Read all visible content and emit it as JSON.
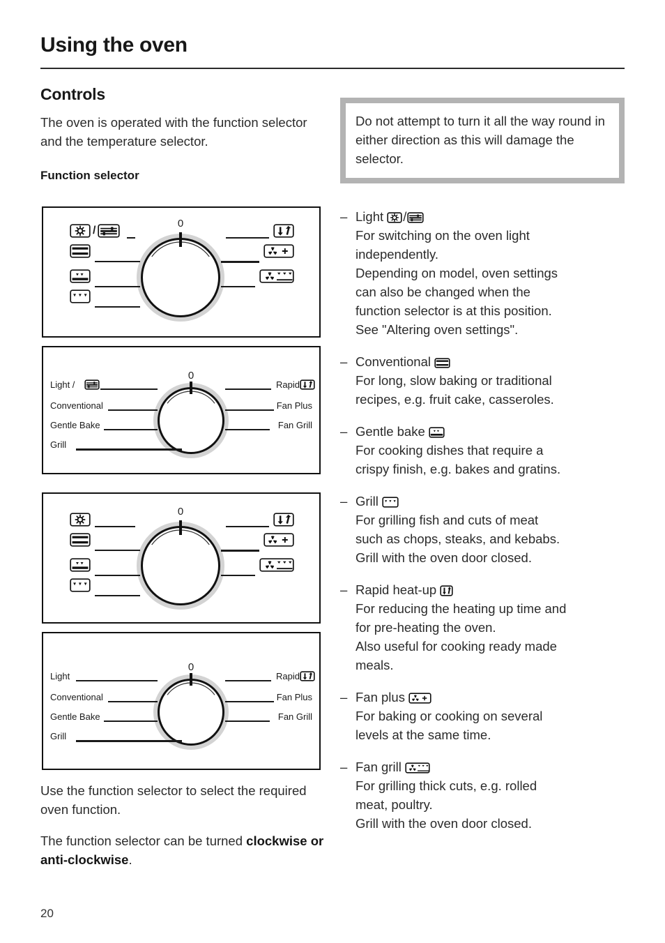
{
  "document": {
    "header_title": "Using the oven",
    "page_number": "20"
  },
  "left": {
    "section_title": "Controls",
    "intro": "The oven is operated with the function selector and the temperature selector.",
    "subsection_title": "Function selector",
    "closing_1": "Use the function selector to select the required oven function.",
    "closing_2_prefix": "The function selector can be turned ",
    "closing_2_bold": "clockwise or anti-clockwise",
    "closing_2_suffix": "."
  },
  "warning": {
    "text": "Do not attempt to turn it all the way round in either direction as this will damage the selector.",
    "border_color": "#b3b3b3"
  },
  "diagrams": [
    {
      "id": "diagram-1",
      "style": "icons",
      "zero_label": "0",
      "left_items": [
        {
          "name": "light-and-settings",
          "icon": "light-slash-settings"
        },
        {
          "name": "conventional",
          "icon": "conventional"
        },
        {
          "name": "gentle-bake",
          "icon": "gentle-bake"
        },
        {
          "name": "grill",
          "icon": "grill"
        }
      ],
      "right_items": [
        {
          "name": "rapid-heat-up",
          "icon": "rapid-heat-up"
        },
        {
          "name": "fan-plus",
          "icon": "fan-plus"
        },
        {
          "name": "fan-grill",
          "icon": "fan-grill"
        }
      ]
    },
    {
      "id": "diagram-2",
      "style": "labels",
      "zero_label": "0",
      "left_items": [
        {
          "name": "light",
          "label": "Light /",
          "icon": "settings"
        },
        {
          "name": "conventional",
          "label": "Conventional"
        },
        {
          "name": "gentle-bake",
          "label": "Gentle Bake"
        },
        {
          "name": "grill",
          "label": "Grill"
        }
      ],
      "right_items": [
        {
          "name": "rapid",
          "label": "Rapid",
          "icon": "rapid-heat-up"
        },
        {
          "name": "fan-plus",
          "label": "Fan Plus"
        },
        {
          "name": "fan-grill",
          "label": "Fan Grill"
        }
      ]
    },
    {
      "id": "diagram-3",
      "style": "icons",
      "zero_label": "0",
      "left_items": [
        {
          "name": "light",
          "icon": "light"
        },
        {
          "name": "conventional",
          "icon": "conventional"
        },
        {
          "name": "gentle-bake",
          "icon": "gentle-bake"
        },
        {
          "name": "grill",
          "icon": "grill"
        }
      ],
      "right_items": [
        {
          "name": "rapid-heat-up",
          "icon": "rapid-heat-up"
        },
        {
          "name": "fan-plus",
          "icon": "fan-plus"
        },
        {
          "name": "fan-grill",
          "icon": "fan-grill"
        }
      ]
    },
    {
      "id": "diagram-4",
      "style": "labels",
      "zero_label": "0",
      "left_items": [
        {
          "name": "light",
          "label": "Light"
        },
        {
          "name": "conventional",
          "label": "Conventional"
        },
        {
          "name": "gentle-bake",
          "label": "Gentle Bake"
        },
        {
          "name": "grill",
          "label": "Grill"
        }
      ],
      "right_items": [
        {
          "name": "rapid",
          "label": "Rapid",
          "icon": "rapid-heat-up"
        },
        {
          "name": "fan-plus",
          "label": "Fan Plus"
        },
        {
          "name": "fan-grill",
          "label": "Fan Grill"
        }
      ]
    }
  ],
  "functions": [
    {
      "name": "light",
      "dash": "–",
      "title": "Light",
      "icons": [
        "light",
        "settings"
      ],
      "icon_separator": "/",
      "lines": [
        "For switching on the oven light",
        "independently.",
        "Depending on model, oven settings",
        "can also be changed when the",
        "function selector is at this position.",
        "See \"Altering oven settings\"."
      ]
    },
    {
      "name": "conventional",
      "dash": "–",
      "title": "Conventional",
      "icons": [
        "conventional"
      ],
      "lines": [
        "For long, slow baking or traditional",
        "recipes, e.g. fruit cake, casseroles."
      ]
    },
    {
      "name": "gentle-bake",
      "dash": "–",
      "title": "Gentle bake",
      "icons": [
        "gentle-bake"
      ],
      "lines": [
        "For cooking dishes that require a",
        "crispy finish, e.g. bakes and gratins."
      ]
    },
    {
      "name": "grill",
      "dash": "–",
      "title": "Grill",
      "icons": [
        "grill"
      ],
      "lines": [
        "For grilling fish and cuts of meat",
        "such as chops, steaks, and kebabs.",
        "Grill with the oven door closed."
      ]
    },
    {
      "name": "rapid-heat-up",
      "dash": "–",
      "title": "Rapid heat-up",
      "icons": [
        "rapid-heat-up"
      ],
      "lines": [
        "For reducing the heating up time and",
        "for pre-heating the oven.",
        "Also useful for cooking ready made",
        "meals."
      ]
    },
    {
      "name": "fan-plus",
      "dash": "–",
      "title": "Fan plus",
      "icons": [
        "fan-plus"
      ],
      "lines": [
        "For baking or cooking on several",
        "levels at the same time."
      ]
    },
    {
      "name": "fan-grill",
      "dash": "–",
      "title": "Fan grill",
      "icons": [
        "fan-grill"
      ],
      "lines": [
        "For grilling thick cuts, e.g. rolled",
        "meat, poultry.",
        "Grill with the oven door closed."
      ]
    }
  ]
}
